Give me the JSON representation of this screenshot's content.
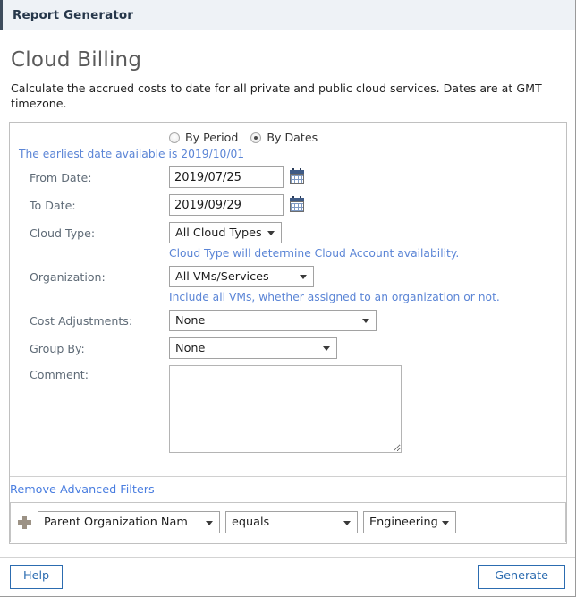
{
  "window": {
    "title": "Report Generator"
  },
  "page": {
    "title": "Cloud Billing",
    "description": "Calculate the accrued costs to date for all private and public cloud services. Dates are at GMT timezone."
  },
  "mode": {
    "by_period_label": "By Period",
    "by_dates_label": "By Dates",
    "selected": "By Dates"
  },
  "earliest_date_hint": "The earliest date available is 2019/10/01",
  "fields": {
    "from_date": {
      "label": "From Date:",
      "value": "2019/07/25",
      "icon": "calendar-icon"
    },
    "to_date": {
      "label": "To Date:",
      "value": "2019/09/29",
      "icon": "calendar-icon"
    },
    "cloud_type": {
      "label": "Cloud Type:",
      "value": "All Cloud Types",
      "hint": "Cloud Type will determine Cloud Account availability."
    },
    "organization": {
      "label": "Organization:",
      "value": "All VMs/Services",
      "hint": "Include all VMs, whether assigned to an organization or not."
    },
    "cost_adjustments": {
      "label": "Cost Adjustments:",
      "value": "None"
    },
    "group_by": {
      "label": "Group By:",
      "value": "None"
    },
    "comment": {
      "label": "Comment:",
      "value": "",
      "placeholder": ""
    }
  },
  "advanced_filters": {
    "toggle_label": "Remove Advanced Filters",
    "add_icon": "plus-icon",
    "rows": [
      {
        "field": "Parent Organization Nam",
        "operator": "equals",
        "value": "Engineering"
      }
    ]
  },
  "footer": {
    "help_label": "Help",
    "generate_label": "Generate"
  },
  "colors": {
    "link_blue": "#4a7ee0",
    "hint_blue": "#5b85d6",
    "button_blue": "#2c6cb0",
    "label_gray": "#5f6b77",
    "title_bar_bg": "#eef2f6"
  }
}
